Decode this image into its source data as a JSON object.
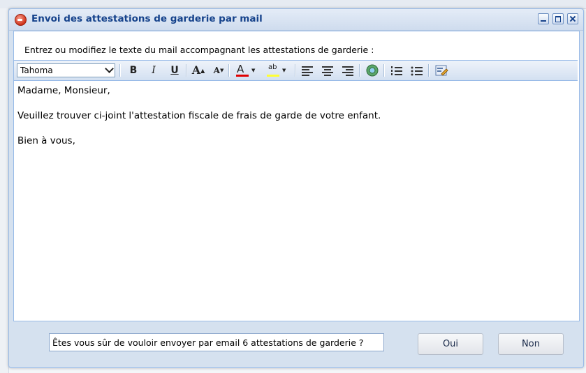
{
  "window": {
    "title": "Envoi des attestations de garderie par mail"
  },
  "instruction": "Entrez ou modifiez le texte du mail accompagnant les attestations de garderie :",
  "toolbar": {
    "font_family": "Tahoma",
    "tools": [
      {
        "name": "bold",
        "glyph": "B"
      },
      {
        "name": "italic",
        "glyph": "I"
      },
      {
        "name": "underline",
        "glyph": "U"
      },
      {
        "name": "grow-font",
        "glyph": "A"
      },
      {
        "name": "shrink-font",
        "glyph": "A"
      },
      {
        "name": "font-color",
        "glyph": "A"
      },
      {
        "name": "highlight-color",
        "glyph": "ab"
      }
    ],
    "font_color": "#e00000",
    "highlight_color": "#ffff33"
  },
  "editor": {
    "lines": [
      "Madame, Monsieur,",
      "Veuillez trouver ci-joint l'attestation fiscale de frais de garde de votre enfant.",
      "Bien à vous,"
    ]
  },
  "footer": {
    "confirmation": "Êtes vous sûr de vouloir envoyer par email  6  attestations de garderie ?",
    "yes_label": "Oui",
    "no_label": "Non"
  },
  "colors": {
    "title_text": "#15428b",
    "panel_border": "#99bbe8"
  }
}
